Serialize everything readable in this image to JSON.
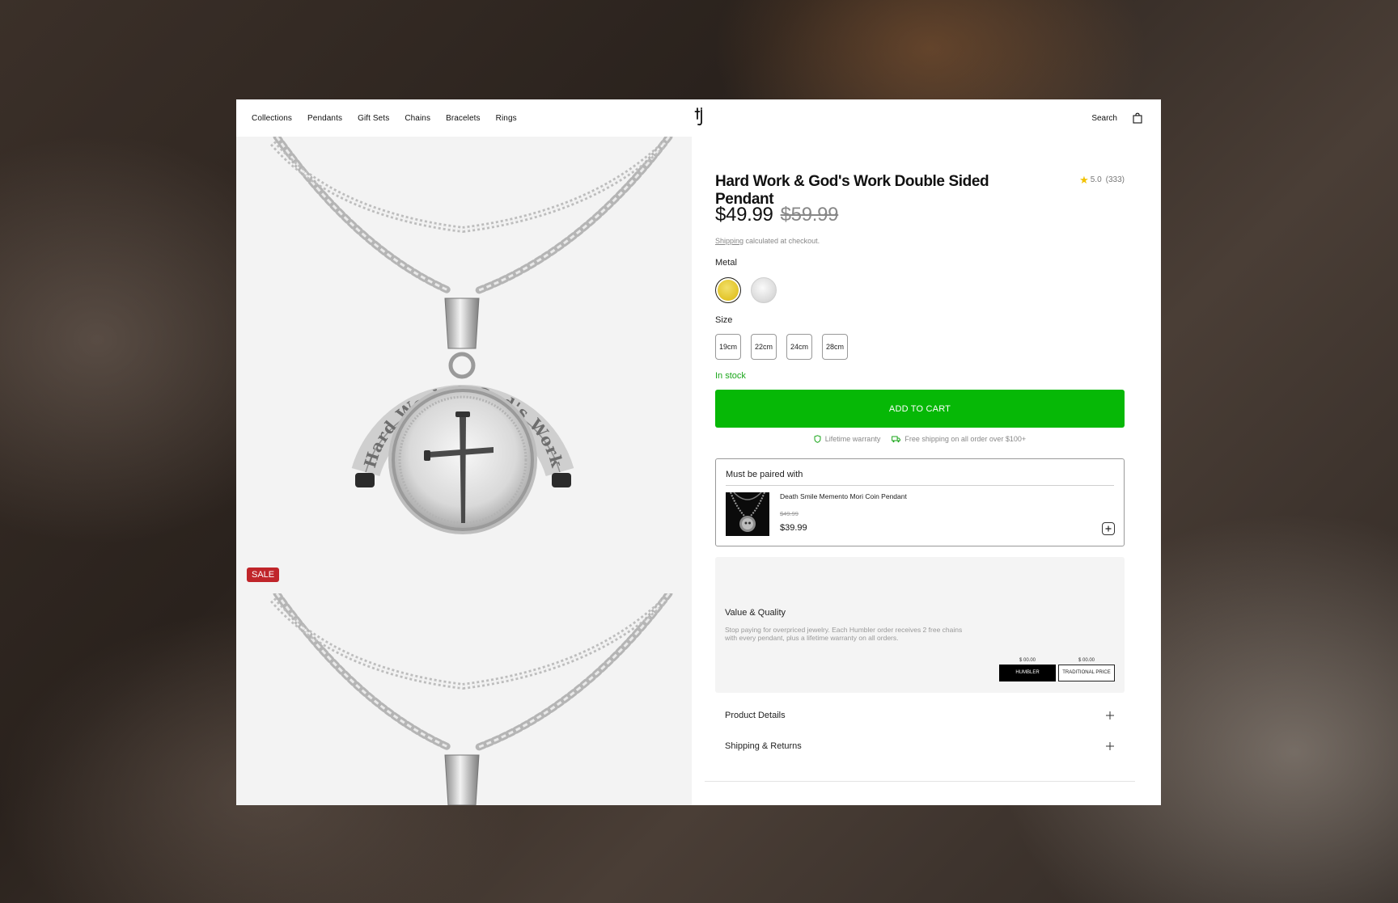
{
  "nav": {
    "links": [
      "Collections",
      "Pendants",
      "Gift Sets",
      "Chains",
      "Bracelets",
      "Rings"
    ],
    "logo_icon": "brand-monogram-logo",
    "search_label": "Search",
    "cart_icon": "shopping-bag-icon"
  },
  "gallery": {
    "badge": "SALE",
    "medallion_text": "Hard Work & God's Work"
  },
  "product": {
    "title": "Hard Work & God's Work Double Sided Pendant",
    "rating": "5.0",
    "review_count": "(333)",
    "price": "$49.99",
    "compare_price": "$59.99",
    "shipping_link": "Shipping",
    "shipping_rest": " calculated at checkout.",
    "metal_label": "Metal",
    "metal_options": [
      {
        "name": "gold",
        "color": "#e3c52a",
        "selected": true
      },
      {
        "name": "silver",
        "color": "#dedede",
        "selected": false
      }
    ],
    "size_label": "Size",
    "sizes": [
      "19cm",
      "22cm",
      "24cm",
      "28cm"
    ],
    "stock": "In stock",
    "add_to_cart": "ADD TO CART",
    "perks": [
      "Lifetime warranty",
      "Free shipping on all order over $100+"
    ]
  },
  "pairing": {
    "title": "Must be paired with",
    "item_name": "Death Smile Memento Mori Coin Pendant",
    "item_old_price": "$49.99",
    "item_price": "$39.99"
  },
  "value_quality": {
    "title": "Value & Quality",
    "text": "Stop paying for overpriced jewelry. Each Humbler order receives 2 free chains with every pendant, plus a lifetime warranty on all orders.",
    "compare": [
      {
        "value": "$ 00.00",
        "label": "HUMBLER"
      },
      {
        "value": "$ 00.00",
        "label": "TRADITIONAL PRICE"
      }
    ]
  },
  "accordion": [
    "Product Details",
    "Shipping & Returns"
  ],
  "colors": {
    "accent_green": "#06b806",
    "stock_green": "#1aa61a",
    "sale_red": "#c0252a",
    "star_yellow": "#f2c200"
  }
}
